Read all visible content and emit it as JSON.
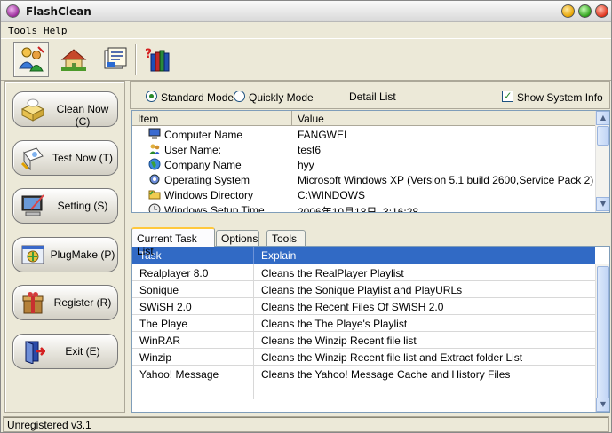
{
  "window": {
    "title": "FlashClean"
  },
  "menu": [
    "Tools",
    "Help"
  ],
  "toolbar": {
    "icons": [
      "clean-people-icon",
      "house-icon",
      "documents-icon",
      "books-help-icon"
    ]
  },
  "left_buttons": [
    {
      "label": "Clean Now (C)",
      "icon": "broom-drawer-icon"
    },
    {
      "label": "Test Now (T)",
      "icon": "test-computer-icon"
    },
    {
      "label": "Setting (S)",
      "icon": "monitor-pen-icon"
    },
    {
      "label": "PlugMake (P)",
      "icon": "plugin-puzzle-icon"
    },
    {
      "label": "Register (R)",
      "icon": "gift-box-icon"
    },
    {
      "label": "Exit (E)",
      "icon": "exit-door-icon"
    }
  ],
  "modes": {
    "standard": "Standard Mode",
    "quickly": "Quickly Mode",
    "selected": "standard",
    "detail_list": "Detail List",
    "show_system_info": "Show System Info",
    "show_system_info_checked": true
  },
  "system_info": {
    "columns": [
      "Item",
      "Value"
    ],
    "rows": [
      {
        "item": "Computer Name",
        "value": "FANGWEI",
        "icon": "computer-icon"
      },
      {
        "item": "User Name:",
        "value": "test6",
        "icon": "users-icon"
      },
      {
        "item": "Company Name",
        "value": "hyy",
        "icon": "globe-icon"
      },
      {
        "item": "Operating System",
        "value": "Microsoft Windows XP (Version 5.1 build 2600,Service Pack 2)",
        "icon": "gear-icon"
      },
      {
        "item": "Windows Directory",
        "value": "C:\\WINDOWS",
        "icon": "folder-icon"
      },
      {
        "item": "Windows Setup Time",
        "value": "2006年10月18日, 3:16:28",
        "icon": "clock-icon"
      }
    ]
  },
  "tabs": [
    "Current Task List",
    "Options",
    "Tools"
  ],
  "selected_tab": "Current Task List",
  "tasks": {
    "columns": [
      "Task",
      "Explain"
    ],
    "rows": [
      {
        "task": "Realplayer 8.0",
        "explain": "Cleans the RealPlayer Playlist"
      },
      {
        "task": "Sonique",
        "explain": "Cleans the Sonique Playlist and PlayURLs"
      },
      {
        "task": "SWiSH 2.0",
        "explain": "Cleans the Recent Files Of SWiSH 2.0"
      },
      {
        "task": "The Playe",
        "explain": "Cleans the The Playe's Playlist"
      },
      {
        "task": "WinRAR",
        "explain": "Cleans the Winzip Recent file list"
      },
      {
        "task": "Winzip",
        "explain": "Cleans the Winzip Recent file list and Extract folder List"
      },
      {
        "task": "Yahoo! Message",
        "explain": "Cleans the Yahoo! Message Cache and History Files"
      }
    ]
  },
  "status": "Unregistered v3.1"
}
